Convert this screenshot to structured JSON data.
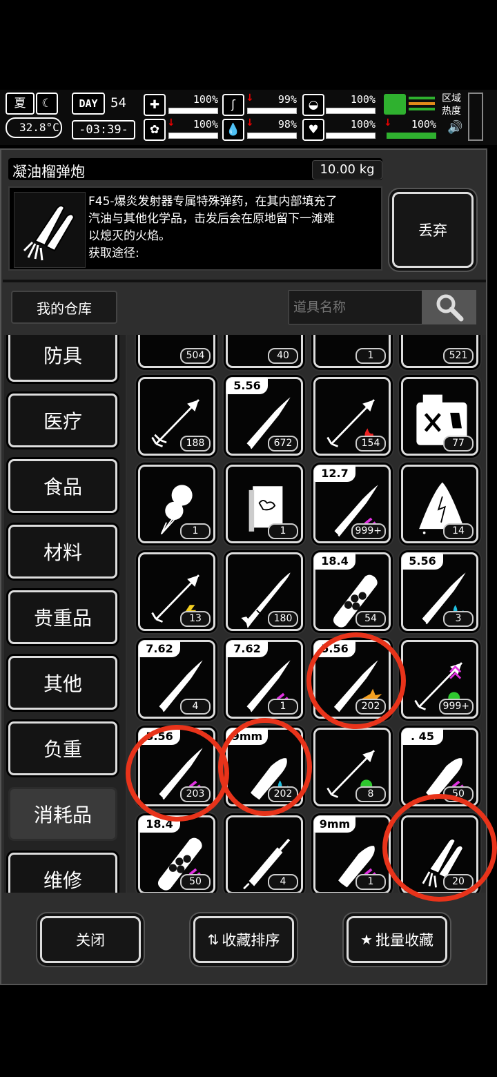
{
  "status": {
    "season": "夏",
    "temperature": "32.8°C",
    "day_label": "DAY",
    "day_number": "54",
    "time": "-03:39-",
    "stats": [
      {
        "name": "health",
        "icon": "medkit-icon",
        "value": "100%",
        "down": false
      },
      {
        "name": "stomach",
        "icon": "stomach-icon",
        "value": "99%",
        "down": true
      },
      {
        "name": "armor",
        "icon": "helmet-icon",
        "value": "100%",
        "down": false
      },
      {
        "name": "brain",
        "icon": "brain-icon",
        "value": "100%",
        "down": true
      },
      {
        "name": "water",
        "icon": "water-drop-icon",
        "value": "98%",
        "down": true
      },
      {
        "name": "heart",
        "icon": "heart-icon",
        "value": "100%",
        "down": false
      },
      {
        "name": "stamina",
        "icon": "boot-icon",
        "value": "100%",
        "down": true
      }
    ],
    "zone_heat": "区域\n热度"
  },
  "item": {
    "name": "凝油榴弹炮",
    "weight": "10.00 kg",
    "description_lines": [
      "F45-爆炎发射器专属特殊弹药，在其内部填充了",
      "汽油与其他化学品，击发后会在原地留下一滩难",
      "以熄灭的火焰。",
      "获取途径:"
    ],
    "discard_label": "丢弃"
  },
  "warehouse_label": "我的仓库",
  "search": {
    "placeholder": "道具名称"
  },
  "categories": [
    {
      "label": "防具",
      "active": false
    },
    {
      "label": "医疗",
      "active": false
    },
    {
      "label": "食品",
      "active": false
    },
    {
      "label": "材料",
      "active": false
    },
    {
      "label": "贵重品",
      "active": false
    },
    {
      "label": "其他",
      "active": false
    },
    {
      "label": "负重",
      "active": false
    },
    {
      "label": "消耗品",
      "active": true
    },
    {
      "label": "维修",
      "active": false
    }
  ],
  "items": [
    {
      "icon": "partial-item-icon",
      "count": "504",
      "caliber": ""
    },
    {
      "icon": "partial-item-icon",
      "count": "40",
      "caliber": ""
    },
    {
      "icon": "partial-item-icon",
      "count": "1",
      "caliber": ""
    },
    {
      "icon": "partial-item-icon",
      "count": "521",
      "caliber": ""
    },
    {
      "icon": "arrow-icon",
      "count": "188",
      "caliber": ""
    },
    {
      "icon": "bullet-icon",
      "count": "672",
      "caliber": "5.56"
    },
    {
      "icon": "fire-arrow-icon",
      "count": "154",
      "caliber": ""
    },
    {
      "icon": "fuel-can-icon",
      "count": "77",
      "caliber": ""
    },
    {
      "icon": "balloon-icon",
      "count": "1",
      "caliber": ""
    },
    {
      "icon": "book-icon",
      "count": "1",
      "caliber": ""
    },
    {
      "icon": "bullet-icon",
      "count": "999+",
      "caliber": "12.7"
    },
    {
      "icon": "tent-icon",
      "count": "14",
      "caliber": ""
    },
    {
      "icon": "shock-arrow-icon",
      "count": "13",
      "caliber": ""
    },
    {
      "icon": "rocket-icon",
      "count": "180",
      "caliber": ""
    },
    {
      "icon": "shotgun-shell-icon",
      "count": "54",
      "caliber": "18.4"
    },
    {
      "icon": "bullet-icon",
      "count": "3",
      "caliber": "5.56"
    },
    {
      "icon": "bullet-icon",
      "count": "4",
      "caliber": "7.62"
    },
    {
      "icon": "bullet-icon",
      "count": "1",
      "caliber": "7.62"
    },
    {
      "icon": "explosive-bullet-icon",
      "count": "202",
      "caliber": "5.56"
    },
    {
      "icon": "poison-arrow-icon",
      "count": "999+",
      "caliber": ""
    },
    {
      "icon": "bullet-icon",
      "count": "203",
      "caliber": "5.56"
    },
    {
      "icon": "pistol-bullet-icon",
      "count": "202",
      "caliber": "9mm"
    },
    {
      "icon": "poison-arrow-icon",
      "count": "8",
      "caliber": ""
    },
    {
      "icon": "pistol-bullet-icon",
      "count": "50",
      "caliber": ". 45"
    },
    {
      "icon": "shotgun-shell-icon",
      "count": "50",
      "caliber": "18.4"
    },
    {
      "icon": "syringe-icon",
      "count": "4",
      "caliber": ""
    },
    {
      "icon": "pistol-bullet-icon",
      "count": "1",
      "caliber": "9mm"
    },
    {
      "icon": "grenade-rocket-icon",
      "count": "20",
      "caliber": ""
    }
  ],
  "buttons": {
    "close": "关闭",
    "sort_favorites": "收藏排序",
    "batch_favorite": "批量收藏"
  },
  "colors": {
    "highlight_circle": "#e8331a",
    "stamina_green": "#2fb12f",
    "down_arrow": "#e00000"
  }
}
